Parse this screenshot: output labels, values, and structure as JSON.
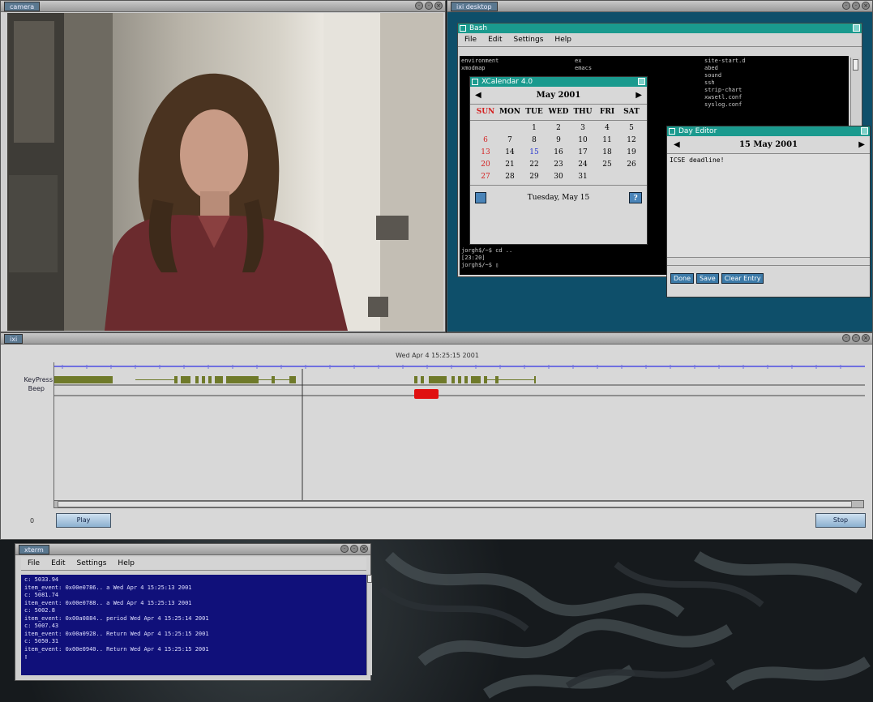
{
  "video_window": {
    "title": "camera"
  },
  "desktop_window": {
    "title": "ixi desktop"
  },
  "bash": {
    "title": "Bash",
    "menu": [
      "File",
      "Edit",
      "Settings",
      "Help"
    ],
    "listing": [
      [
        "environment",
        "ex",
        "site-start.d"
      ],
      [
        "xmodmap",
        "emacs",
        "abed"
      ],
      [
        "",
        "",
        "sound"
      ],
      [
        "",
        "",
        "ssh"
      ],
      [
        "",
        "",
        "strip-chart"
      ],
      [
        "",
        "",
        "xwsetl.conf"
      ],
      [
        "",
        "",
        "syslog.conf"
      ]
    ],
    "prompt_lines": [
      "jorgh$/~$ cd ..",
      "[23:20]",
      "jorgh$/~$ ▯"
    ]
  },
  "calendar": {
    "title": "XCalendar 4.0",
    "month": "May 2001",
    "weekdays": [
      "SUN",
      "MON",
      "TUE",
      "WED",
      "THU",
      "FRI",
      "SAT"
    ],
    "weeks": [
      [
        "",
        "",
        "1",
        "2",
        "3",
        "4",
        "5"
      ],
      [
        "6",
        "7",
        "8",
        "9",
        "10",
        "11",
        "12"
      ],
      [
        "13",
        "14",
        "15",
        "16",
        "17",
        "18",
        "19"
      ],
      [
        "20",
        "21",
        "22",
        "23",
        "24",
        "25",
        "26"
      ],
      [
        "27",
        "28",
        "29",
        "30",
        "31",
        "",
        ""
      ]
    ],
    "today_label": "Tuesday, May 15",
    "colors": {
      "sunday": "#d42020",
      "today": "#2030d0"
    }
  },
  "day_editor": {
    "title": "Day Editor",
    "date": "15 May 2001",
    "entry": "ICSE deadline!",
    "buttons": [
      "Done",
      "Save",
      "Clear Entry"
    ]
  },
  "ixi": {
    "title": "ixi",
    "timestamp": "Wed Apr  4 15:25:15 2001",
    "tracks": [
      "KeyPress",
      "Beep"
    ],
    "zero_label": "0",
    "play_label": "Play",
    "stop_label": "Stop",
    "colors": {
      "keypress": "#6f7a2a",
      "beep": "#e01010",
      "ruler": "#7070e0"
    }
  },
  "xterm": {
    "title": "xterm",
    "menu": [
      "File",
      "Edit",
      "Settings",
      "Help"
    ],
    "lines": [
      "c: 5033.94",
      "item_event: 0x00e0786.. a Wed Apr  4 15:25:13 2001",
      "c: 5081.74",
      "item_event: 0x00e0788.. a Wed Apr  4 15:25:13 2001",
      "c: 5002.8",
      "item_event: 0x00a0884.. period Wed Apr  4 15:25:14 2001",
      "c: 5007.43",
      "item_event: 0x00a0928.. Return Wed Apr  4 15:25:15 2001",
      "c: 5050.31",
      "item_event: 0x00e0940.. Return Wed Apr  4 15:25:15 2001"
    ]
  }
}
